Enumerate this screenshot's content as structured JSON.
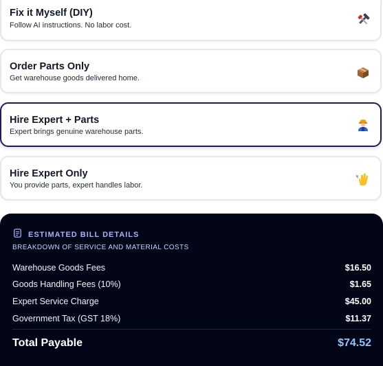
{
  "options": [
    {
      "title": "Fix it Myself (DIY)",
      "description": "Follow AI instructions. No labor cost.",
      "icon": "tools-icon",
      "selected": false
    },
    {
      "title": "Order Parts Only",
      "description": "Get warehouse goods delivered home.",
      "icon": "package-icon",
      "selected": false
    },
    {
      "title": "Hire Expert + Parts",
      "description": "Expert brings genuine warehouse parts.",
      "icon": "worker-icon",
      "selected": true
    },
    {
      "title": "Hire Expert Only",
      "description": "You provide parts, expert handles labor.",
      "icon": "hand-wave-icon",
      "selected": false
    }
  ],
  "bill": {
    "title": "ESTIMATED BILL DETAILS",
    "subtitle": "BREAKDOWN OF SERVICE AND MATERIAL COSTS",
    "icon": "receipt-icon",
    "items": [
      {
        "label": "Warehouse Goods Fees",
        "amount": "$16.50"
      },
      {
        "label": "Goods Handling Fees (10%)",
        "amount": "$1.65"
      },
      {
        "label": "Expert Service Charge",
        "amount": "$45.00"
      },
      {
        "label": "Government Tax (GST 18%)",
        "amount": "$11.37"
      }
    ],
    "total_label": "Total Payable",
    "total_amount": "$74.52"
  },
  "colors": {
    "selected_border": "#1c1a5a",
    "panel_background": "#020617",
    "accent": "#a5b4fc",
    "total_amount": "#93c5fd"
  }
}
